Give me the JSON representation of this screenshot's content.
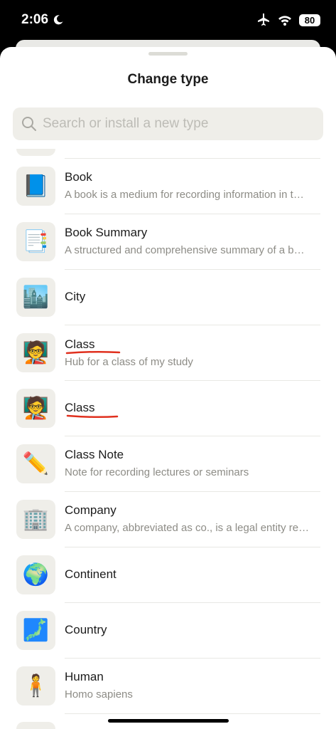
{
  "status": {
    "time": "2:06",
    "battery": "80"
  },
  "sheet": {
    "title": "Change type"
  },
  "search": {
    "placeholder": "Search or install a new type"
  },
  "items": [
    {
      "title": "Book",
      "description": "A book is a medium for recording information in the form of writing or images",
      "icon": "blue-book-icon",
      "glyph": "📘"
    },
    {
      "title": "Book Summary",
      "description": "A structured and comprehensive summary of a book",
      "icon": "document-icon",
      "glyph": "📑"
    },
    {
      "title": "City",
      "description": "",
      "icon": "cityscape-icon",
      "glyph": "🏙️"
    },
    {
      "title": "Class",
      "description": "Hub for a class of my study",
      "icon": "teacher-icon",
      "glyph": "🧑‍🏫"
    },
    {
      "title": "Class",
      "description": "",
      "icon": "teacher-icon",
      "glyph": "🧑‍🏫"
    },
    {
      "title": "Class Note",
      "description": "Note for recording lectures or seminars",
      "icon": "pencil-icon",
      "glyph": "✏️"
    },
    {
      "title": "Company",
      "description": "A company, abbreviated as co., is a legal entity representing an association",
      "icon": "office-building-icon",
      "glyph": "🏢"
    },
    {
      "title": "Continent",
      "description": "",
      "icon": "globe-icon",
      "glyph": "🌍"
    },
    {
      "title": "Country",
      "description": "",
      "icon": "map-icon",
      "glyph": "🗾"
    },
    {
      "title": "Human",
      "description": "Homo sapiens",
      "icon": "person-icon",
      "glyph": "🧍"
    }
  ],
  "colors": {
    "accent_underline": "#e0301e",
    "tile_bg": "#efeee9",
    "secondary_text": "#8d8c86"
  }
}
